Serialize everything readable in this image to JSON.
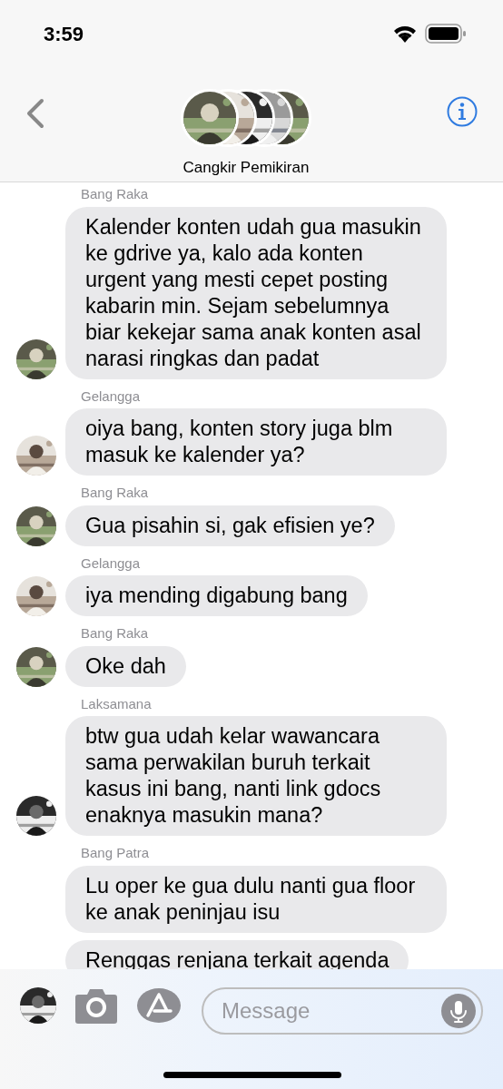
{
  "status_bar": {
    "time": "3:59"
  },
  "header": {
    "title": "Cangkir Pemikiran"
  },
  "groups": [
    {
      "sender": "Bang Raka",
      "avatar_shown": true,
      "bubbles": [
        "Kalender konten udah gua masukin ke gdrive ya, kalo ada konten urgent yang mesti cepet posting kabarin min. Sejam sebelumnya biar kekejar sama anak konten asal narasi ringkas dan padat"
      ]
    },
    {
      "sender": "Gelangga",
      "avatar_shown": true,
      "bubbles": [
        "oiya bang, konten story juga blm masuk ke kalender ya?"
      ]
    },
    {
      "sender": "Bang Raka",
      "avatar_shown": true,
      "bubbles": [
        "Gua pisahin si, gak efisien ye?"
      ]
    },
    {
      "sender": "Gelangga",
      "avatar_shown": true,
      "bubbles": [
        "iya mending digabung bang"
      ]
    },
    {
      "sender": "Bang Raka",
      "avatar_shown": true,
      "bubbles": [
        "Oke dah"
      ]
    },
    {
      "sender": "Laksamana",
      "avatar_shown": true,
      "bubbles": [
        "btw gua udah kelar wawancara sama perwakilan buruh terkait kasus ini bang, nanti link gdocs enaknya masukin mana?"
      ]
    },
    {
      "sender": "Bang Patra",
      "avatar_shown": false,
      "bubbles": [
        "Lu oper ke gua dulu nanti gua floor ke anak peninjau isu",
        "Renggas renjana terkait agenda"
      ]
    }
  ],
  "composer": {
    "placeholder": "Message"
  }
}
